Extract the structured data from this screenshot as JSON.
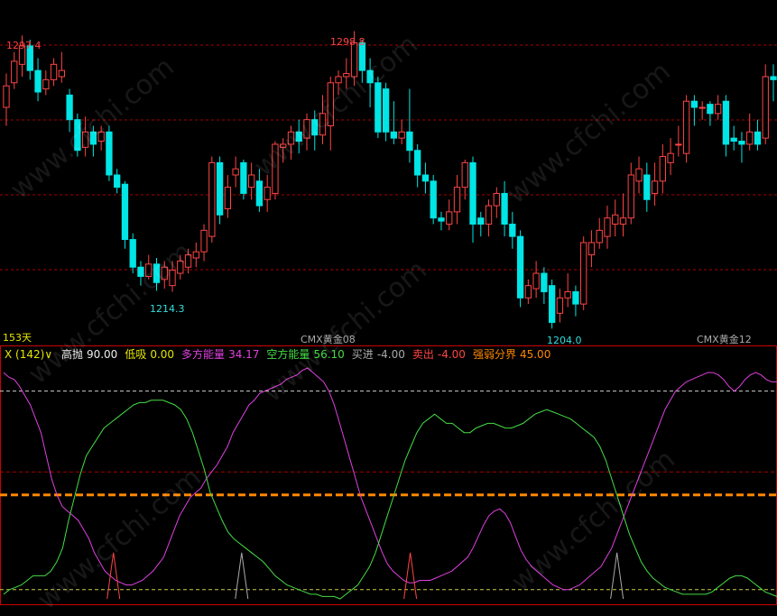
{
  "watermark": "www.cfchi.com",
  "colors": {
    "up": "#ff4444",
    "down": "#00e5e5",
    "magenta": "#e040e0",
    "green": "#44dd44",
    "orange": "#ff8800",
    "grid": "#aa0000",
    "white_dash": "#cccccc",
    "yellow_dash": "#cccc44",
    "yellow_text": "#e6e600",
    "red_text": "#ff4444",
    "cyan_text": "#33dddd",
    "gray_text": "#aaaaaa",
    "white_text": "#eeeeee"
  },
  "price_panel": {
    "period_label": "153天",
    "contract_label_1": "CMX黄金08",
    "contract_label_2": "CMX黄金12",
    "annotations": {
      "high_1": "1297.4",
      "high_2": "1298.8",
      "low_1": "1214.3",
      "low_2": "1204.0"
    }
  },
  "indicator_panel": {
    "name": "X (142)",
    "dropdown_icon": "chevron-down-icon",
    "items": [
      {
        "label": "高抛",
        "value": "90.00",
        "label_color": "#eeeeee",
        "value_color": "#eeeeee"
      },
      {
        "label": "低吸",
        "value": "0.00",
        "label_color": "#e6e600",
        "value_color": "#e6e600"
      },
      {
        "label": "多方能量",
        "value": "34.17",
        "label_color": "#e040e0",
        "value_color": "#e040e0"
      },
      {
        "label": "空方能量",
        "value": "56.10",
        "label_color": "#44dd44",
        "value_color": "#44dd44"
      },
      {
        "label": "买进",
        "value": "-4.00",
        "label_color": "#aaaaaa",
        "value_color": "#aaaaaa"
      },
      {
        "label": "卖出",
        "value": "-4.00",
        "label_color": "#ff4444",
        "value_color": "#ff4444"
      },
      {
        "label": "强弱分界",
        "value": "45.00",
        "label_color": "#ff8800",
        "value_color": "#ff8800"
      }
    ]
  },
  "chart_data": [
    {
      "type": "candlestick",
      "title": "",
      "ylim": [
        1198,
        1306
      ],
      "candles": [
        [
          1274,
          1281,
          1268,
          1285
        ],
        [
          1282,
          1289,
          1280,
          1292
        ],
        [
          1288,
          1294,
          1284,
          1297.4
        ],
        [
          1294,
          1286,
          1283,
          1296
        ],
        [
          1286,
          1279,
          1276,
          1290
        ],
        [
          1280,
          1283,
          1278,
          1286
        ],
        [
          1283,
          1288,
          1281,
          1290
        ],
        [
          1284,
          1286,
          1282,
          1292
        ],
        [
          1278,
          1270,
          1266,
          1280
        ],
        [
          1270,
          1260,
          1258,
          1272
        ],
        [
          1261,
          1266,
          1258,
          1271
        ],
        [
          1266,
          1262,
          1258,
          1268
        ],
        [
          1263,
          1266,
          1260,
          1268
        ],
        [
          1266,
          1252,
          1250,
          1268
        ],
        [
          1252,
          1248,
          1246,
          1254
        ],
        [
          1249,
          1231,
          1228,
          1250
        ],
        [
          1231,
          1222,
          1220,
          1233
        ],
        [
          1222,
          1219,
          1216,
          1224
        ],
        [
          1219,
          1223,
          1218,
          1226
        ],
        [
          1223,
          1217,
          1214.3,
          1225
        ],
        [
          1218,
          1222,
          1215,
          1224
        ],
        [
          1216,
          1221,
          1214,
          1224
        ],
        [
          1220,
          1224,
          1218,
          1226
        ],
        [
          1222,
          1226,
          1220,
          1228
        ],
        [
          1225,
          1227,
          1222,
          1230
        ],
        [
          1227,
          1234,
          1224,
          1236
        ],
        [
          1232,
          1256,
          1230,
          1258
        ],
        [
          1256,
          1239,
          1236,
          1258
        ],
        [
          1241,
          1248,
          1238,
          1252
        ],
        [
          1252,
          1254,
          1248,
          1258
        ],
        [
          1256,
          1246,
          1244,
          1257
        ],
        [
          1248,
          1252,
          1244,
          1256
        ],
        [
          1250,
          1242,
          1240,
          1254
        ],
        [
          1244,
          1248,
          1240,
          1252
        ],
        [
          1246,
          1262,
          1244,
          1263
        ],
        [
          1261,
          1262,
          1256,
          1264
        ],
        [
          1262,
          1266,
          1257,
          1268
        ],
        [
          1266,
          1263,
          1259,
          1270
        ],
        [
          1264,
          1270,
          1260,
          1272
        ],
        [
          1270,
          1265,
          1260,
          1273
        ],
        [
          1265,
          1272,
          1262,
          1278
        ],
        [
          1268,
          1282,
          1260,
          1284
        ],
        [
          1282,
          1284,
          1278,
          1286
        ],
        [
          1284,
          1285,
          1280,
          1290
        ],
        [
          1284,
          1295,
          1281,
          1298.8
        ],
        [
          1295,
          1286,
          1282,
          1296
        ],
        [
          1286,
          1282,
          1274,
          1290
        ],
        [
          1282,
          1266,
          1264,
          1284
        ],
        [
          1280,
          1266,
          1263,
          1282
        ],
        [
          1266,
          1264,
          1262,
          1276
        ],
        [
          1264,
          1266,
          1262,
          1270
        ],
        [
          1266,
          1260,
          1256,
          1280
        ],
        [
          1260,
          1252,
          1248,
          1262
        ],
        [
          1252,
          1250,
          1246,
          1256
        ],
        [
          1250,
          1238,
          1236,
          1252
        ],
        [
          1238,
          1237,
          1234,
          1240
        ],
        [
          1236,
          1240,
          1234,
          1244
        ],
        [
          1240,
          1248,
          1236,
          1252
        ],
        [
          1248,
          1256,
          1244,
          1257
        ],
        [
          1256,
          1236,
          1230,
          1258
        ],
        [
          1238,
          1236,
          1232,
          1240
        ],
        [
          1236,
          1242,
          1232,
          1244
        ],
        [
          1242,
          1246,
          1238,
          1248
        ],
        [
          1246,
          1236,
          1232,
          1250
        ],
        [
          1236,
          1232,
          1228,
          1240
        ],
        [
          1232,
          1212,
          1209,
          1234
        ],
        [
          1212,
          1216,
          1210,
          1218
        ],
        [
          1215,
          1220,
          1212,
          1224
        ],
        [
          1220,
          1214,
          1210,
          1222
        ],
        [
          1216,
          1204,
          1202,
          1218
        ],
        [
          1207,
          1212,
          1204,
          1215
        ],
        [
          1212,
          1214,
          1209,
          1220
        ],
        [
          1214,
          1210,
          1206,
          1216
        ],
        [
          1210,
          1230,
          1208,
          1232
        ],
        [
          1226,
          1230,
          1222,
          1234
        ],
        [
          1230,
          1234,
          1228,
          1238
        ],
        [
          1232,
          1238,
          1228,
          1242
        ],
        [
          1236,
          1239,
          1232,
          1244
        ],
        [
          1236,
          1238,
          1232,
          1246
        ],
        [
          1238,
          1252,
          1236,
          1256
        ],
        [
          1250,
          1254,
          1246,
          1258
        ],
        [
          1252,
          1244,
          1240,
          1256
        ],
        [
          1246,
          1250,
          1242,
          1256
        ],
        [
          1250,
          1258,
          1246,
          1262
        ],
        [
          1256,
          1259,
          1252,
          1264
        ],
        [
          1262,
          1262,
          1258,
          1268
        ],
        [
          1259,
          1276,
          1256,
          1278
        ],
        [
          1276,
          1274,
          1268,
          1278
        ],
        [
          1274,
          1274,
          1270,
          1276
        ],
        [
          1275,
          1272,
          1268,
          1276
        ],
        [
          1272,
          1275,
          1270,
          1278
        ],
        [
          1276,
          1262,
          1258,
          1278
        ],
        [
          1264,
          1263,
          1260,
          1268
        ],
        [
          1263,
          1262,
          1256,
          1266
        ],
        [
          1262,
          1266,
          1260,
          1272
        ],
        [
          1266,
          1262,
          1260,
          1270
        ],
        [
          1264,
          1284,
          1262,
          1288
        ],
        [
          1284,
          1283,
          1276,
          1288
        ]
      ]
    },
    {
      "type": "line",
      "title": "",
      "ylim": [
        0,
        100
      ],
      "reference_lines": [
        {
          "name": "高抛",
          "value": 90
        },
        {
          "name": "强弱分界",
          "value": 45
        },
        {
          "name": "低吸",
          "value": 0
        }
      ],
      "series": [
        {
          "name": "多方能量",
          "values": [
            98,
            96,
            95,
            92,
            88,
            84,
            78,
            72,
            62,
            52,
            45,
            40,
            38,
            36,
            34,
            30,
            26,
            20,
            16,
            12,
            10,
            8,
            7,
            6,
            6,
            7,
            8,
            10,
            12,
            15,
            18,
            24,
            30,
            36,
            40,
            44,
            46,
            48,
            52,
            55,
            58,
            62,
            66,
            72,
            76,
            80,
            84,
            86,
            89,
            90,
            91,
            92,
            93,
            95,
            96,
            97,
            99,
            100,
            98,
            96,
            94,
            90,
            84,
            76,
            68,
            60,
            52,
            44,
            38,
            32,
            26,
            20,
            15,
            12,
            10,
            8,
            7,
            7,
            8,
            8,
            8,
            9,
            10,
            11,
            12,
            14,
            16,
            18,
            22,
            27,
            32,
            36,
            38,
            39,
            37,
            33,
            27,
            21,
            17,
            14,
            12,
            10,
            8,
            6,
            5,
            4,
            4,
            5,
            6,
            8,
            10,
            12,
            14,
            18,
            22,
            28,
            34,
            40,
            46,
            52,
            58,
            64,
            70,
            76,
            82,
            86,
            90,
            92,
            94,
            95,
            96,
            97,
            98,
            98,
            97,
            95,
            92,
            90,
            92,
            95,
            97,
            98,
            97,
            95,
            94,
            94
          ]
        },
        {
          "name": "空方能量",
          "values": [
            2,
            4,
            5,
            6,
            8,
            10,
            10,
            10,
            12,
            16,
            22,
            34,
            44,
            54,
            62,
            66,
            70,
            74,
            76,
            78,
            80,
            82,
            84,
            85,
            85,
            86,
            86,
            86,
            85,
            84,
            82,
            78,
            72,
            64,
            56,
            46,
            40,
            34,
            29,
            26,
            24,
            22,
            20,
            18,
            16,
            13,
            10,
            8,
            6,
            5,
            4,
            3,
            2,
            2,
            1,
            1,
            1,
            0,
            2,
            4,
            6,
            10,
            14,
            20,
            28,
            36,
            44,
            52,
            60,
            66,
            72,
            76,
            78,
            80,
            78,
            76,
            76,
            74,
            72,
            72,
            74,
            75,
            76,
            76,
            75,
            74,
            74,
            75,
            76,
            78,
            80,
            81,
            82,
            81,
            80,
            79,
            78,
            76,
            74,
            72,
            70,
            66,
            60,
            52,
            44,
            36,
            28,
            22,
            16,
            12,
            9,
            7,
            5,
            4,
            3,
            2,
            2,
            2,
            2,
            2,
            3,
            5,
            7,
            9,
            10,
            10,
            9,
            7,
            5,
            3,
            2,
            1
          ]
        },
        {
          "name": "卖出",
          "values": [
            0,
            0,
            0,
            0,
            0,
            0,
            0,
            0,
            0,
            0,
            0,
            0,
            0,
            0,
            0,
            0,
            0,
            0,
            0,
            0,
            0,
            0,
            0,
            0,
            0,
            0,
            0,
            0,
            0,
            0,
            0,
            0,
            0,
            0,
            0,
            0,
            0,
            0,
            0,
            0,
            0,
            0,
            0,
            0,
            0,
            0,
            0,
            0,
            0,
            0,
            0,
            0,
            0,
            0,
            0,
            0,
            0,
            0,
            0,
            0,
            0,
            0,
            0,
            0,
            0,
            0,
            0,
            0,
            0,
            0,
            0,
            0,
            0,
            0,
            0,
            0,
            0,
            0,
            0,
            0,
            0,
            0,
            0,
            0,
            0,
            0,
            0,
            0,
            0,
            0,
            0,
            0,
            0,
            0,
            0,
            0,
            0,
            0,
            0,
            0,
            0,
            0,
            0,
            0,
            0,
            0,
            0,
            0,
            0,
            0,
            0,
            0,
            0,
            0,
            0,
            0,
            0,
            0,
            0,
            0,
            0,
            0,
            0,
            0,
            0,
            0,
            0,
            0,
            0,
            0,
            0,
            0,
            0,
            0,
            0,
            0,
            0,
            0,
            0,
            0,
            0,
            0,
            0,
            0,
            0,
            0,
            0
          ]
        }
      ],
      "signal_spikes_x": [
        0.146,
        0.311,
        0.528,
        0.794
      ],
      "signal_spike_height": 20
    }
  ]
}
